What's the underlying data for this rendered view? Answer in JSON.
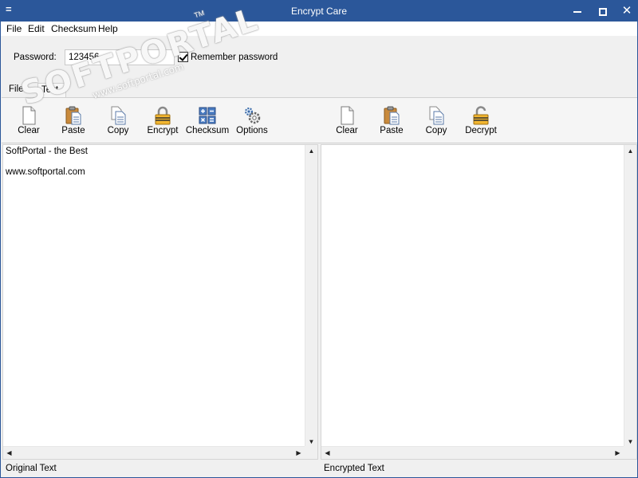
{
  "window": {
    "title": "Encrypt Care",
    "sysmenu_glyph": "=",
    "close_glyph": "✕"
  },
  "menu": {
    "items": [
      "File",
      "Edit",
      "Checksum",
      "Help"
    ]
  },
  "password": {
    "label": "Password:",
    "value": "123456",
    "remember_label": "Remember password",
    "remember_checked": true
  },
  "tabs": [
    "Files",
    "Text"
  ],
  "toolbar_left": [
    {
      "label": "Clear",
      "icon": "blank-page-icon"
    },
    {
      "label": "Paste",
      "icon": "paste-clipboard-icon"
    },
    {
      "label": "Copy",
      "icon": "copy-pages-icon"
    },
    {
      "label": "Encrypt",
      "icon": "lock-closed-icon"
    },
    {
      "label": "Checksum",
      "icon": "checksum-grid-icon"
    },
    {
      "label": "Options",
      "icon": "gears-icon"
    }
  ],
  "toolbar_right": [
    {
      "label": "Clear",
      "icon": "blank-page-icon"
    },
    {
      "label": "Paste",
      "icon": "paste-clipboard-icon"
    },
    {
      "label": "Copy",
      "icon": "copy-pages-icon"
    },
    {
      "label": "Decrypt",
      "icon": "lock-open-icon"
    }
  ],
  "left_text": "SoftPortal - the Best\n\nwww.softportal.com",
  "right_text": "",
  "status": {
    "left": "Original Text",
    "right": "Encrypted Text"
  },
  "scroll": {
    "up": "▲",
    "down": "▼",
    "left": "◀",
    "right": "▶"
  },
  "watermark": {
    "logo": "SOFTPORTAL",
    "url": "www.softportal.com",
    "tm": "TM"
  },
  "colors": {
    "titlebar": "#2b579a",
    "toolbar_bg": "#f5f5f5"
  }
}
